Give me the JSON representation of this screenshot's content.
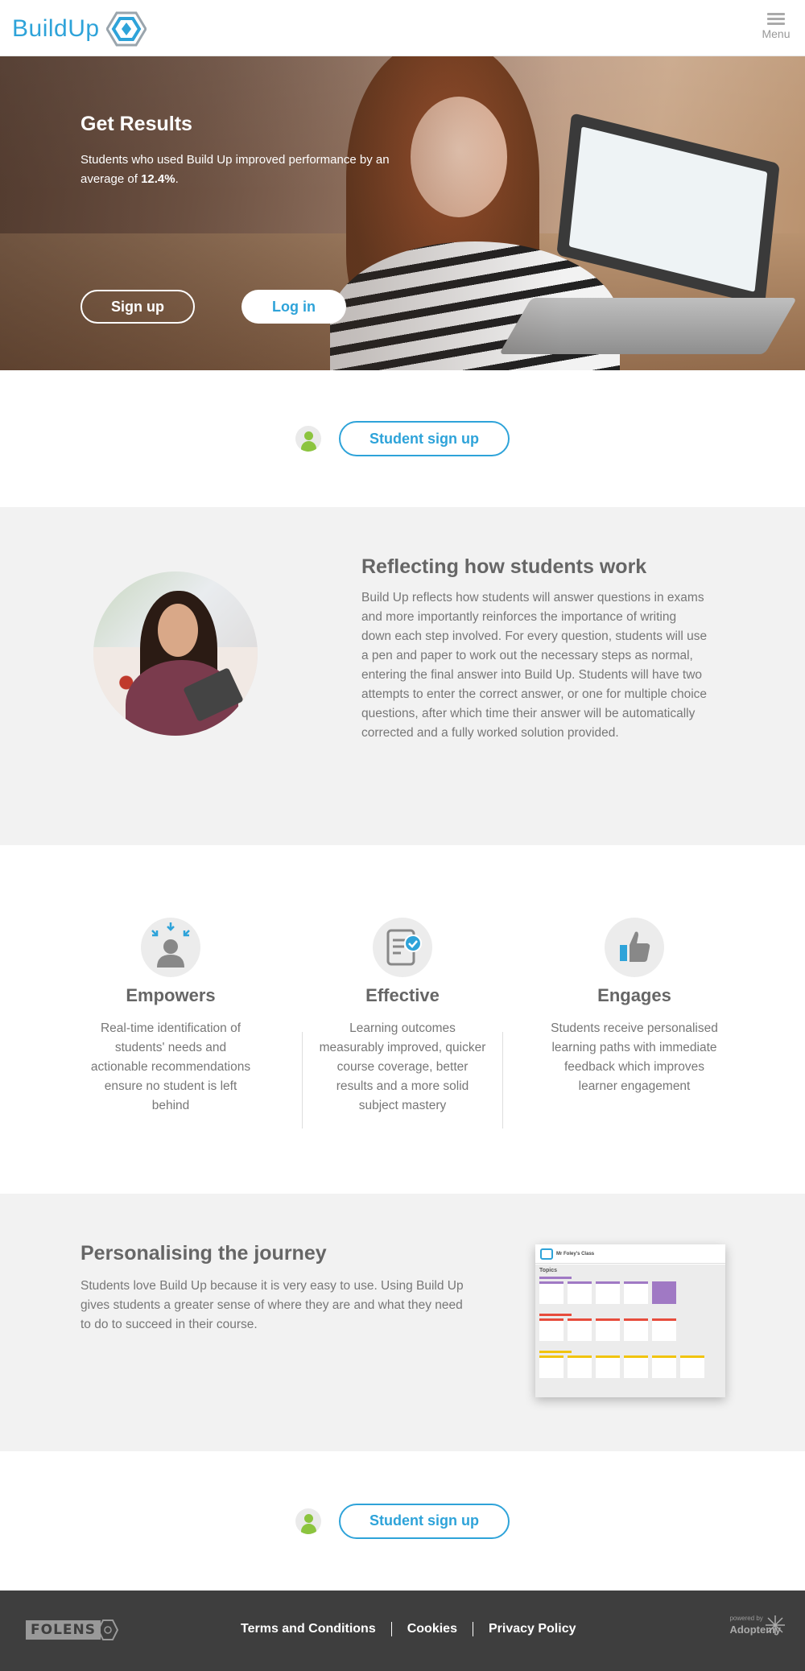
{
  "header": {
    "logo_text": "BuildUp",
    "menu_label": "Menu"
  },
  "hero": {
    "title": "Get Results",
    "text_before": "Students who used Build Up improved performance by an average of",
    "text_bold": "12.4%",
    "text_after": ".",
    "signup_label": "Sign up",
    "login_label": "Log in"
  },
  "signup_cta": {
    "label": "Student sign up"
  },
  "reflecting": {
    "title": "Reflecting how students work",
    "body": "Build Up reflects how students will answer questions in exams and more importantly reinforces the importance of writing down each step involved. For every question, students will use a pen and paper to work out the necessary steps as normal, entering the final answer into Build Up. Students will have two attempts to enter the correct answer, or one for multiple choice questions, after which time their answer will be automatically corrected and a fully worked solution provided."
  },
  "features": [
    {
      "icon": "person-focus-icon",
      "title": "Empowers",
      "text": "Real-time identification of students' needs and actionable recommendations ensure no student is left behind"
    },
    {
      "icon": "checklist-icon",
      "title": "Effective",
      "text": "Learning outcomes measurably improved, quicker course coverage, better results and a more solid subject mastery"
    },
    {
      "icon": "thumbs-up-icon",
      "title": "Engages",
      "text": "Students receive personalised learning paths with immediate feedback which improves learner engagement"
    }
  ],
  "personalising": {
    "title": "Personalising the journey",
    "body": "Students love Build Up because it is very easy to use. Using Build Up gives students a greater sense of where they are and what they need to do to succeed in their course.",
    "screenshot_title": "Mr Foley's Class",
    "screenshot_topics": "Topics"
  },
  "footer": {
    "folens_text": "FOLENS",
    "links": [
      "Terms and Conditions",
      "Cookies",
      "Privacy Policy"
    ],
    "powered_by": "powered by",
    "adoptemy": "Adoptemy"
  },
  "colors": {
    "brand_blue": "#2ea3d9",
    "student_green": "#8cc43f",
    "footer_bg": "#3e3e3e",
    "section_grey": "#f2f2f2"
  }
}
